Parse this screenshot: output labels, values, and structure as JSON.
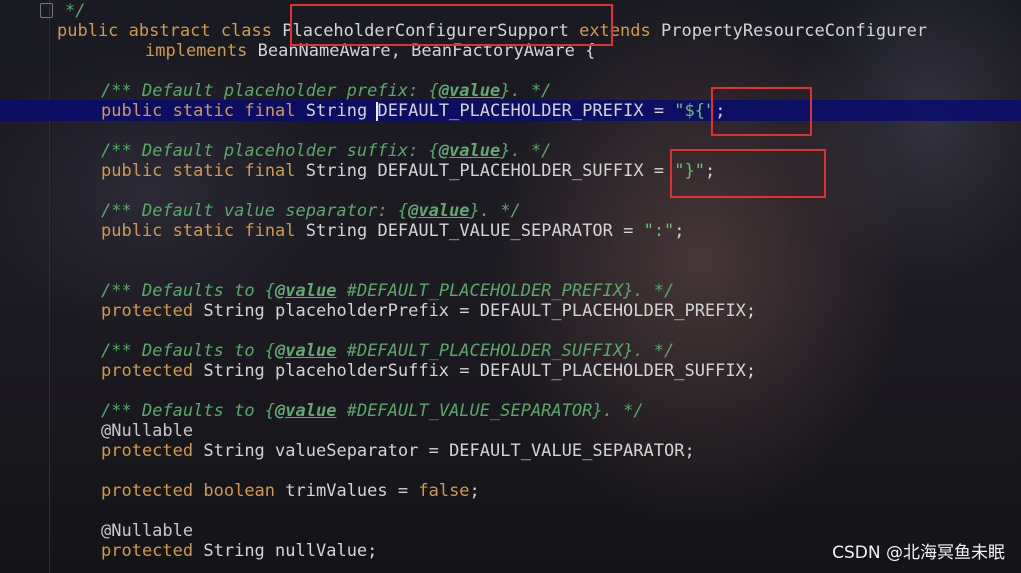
{
  "editor": {
    "comment_end": "*/",
    "class_decl": {
      "public": "public",
      "abstract": "abstract",
      "class": "class",
      "class_name": "PlaceholderConfigurerSupport",
      "extends": "extends",
      "super_class": "PropertyResourceConfigurer",
      "implements": "implements",
      "interfaces": "BeanNameAware, BeanFactoryAware {"
    },
    "keywords": {
      "public": "public",
      "static": "static",
      "final": "final",
      "protected": "protected",
      "boolean": "boolean",
      "false": "false"
    },
    "types": {
      "string": "String"
    },
    "annotations": {
      "nullable": "@Nullable"
    },
    "javadoc": {
      "open": "/**",
      "close": "*/",
      "value_tag": "@value",
      "prefix_doc": "Default placeholder prefix:",
      "suffix_doc": "Default placeholder suffix:",
      "separator_doc": "Default value separator:",
      "defaults_to": "Defaults to"
    },
    "constants": {
      "prefix_name": "DEFAULT_PLACEHOLDER_PREFIX",
      "prefix_value": "\"${\"",
      "suffix_name": "DEFAULT_PLACEHOLDER_SUFFIX",
      "suffix_value": "\"}\"",
      "separator_name": "DEFAULT_VALUE_SEPARATOR",
      "separator_value": "\":\""
    },
    "refs": {
      "prefix": "#DEFAULT_PLACEHOLDER_PREFIX",
      "suffix": "#DEFAULT_PLACEHOLDER_SUFFIX",
      "separator": "#DEFAULT_VALUE_SEPARATOR"
    },
    "fields": {
      "placeholder_prefix": "placeholderPrefix",
      "placeholder_suffix": "placeholderSuffix",
      "value_separator": "valueSeparator",
      "trim_values": "trimValues",
      "null_value": "nullValue"
    }
  },
  "watermark": "CSDN @北海冥鱼未眠",
  "colors": {
    "keyword": "#d19a4a",
    "comment": "#59a868",
    "string": "#6ebf72",
    "highlight_box": "#e03030",
    "caret_line": "#080c6e"
  }
}
